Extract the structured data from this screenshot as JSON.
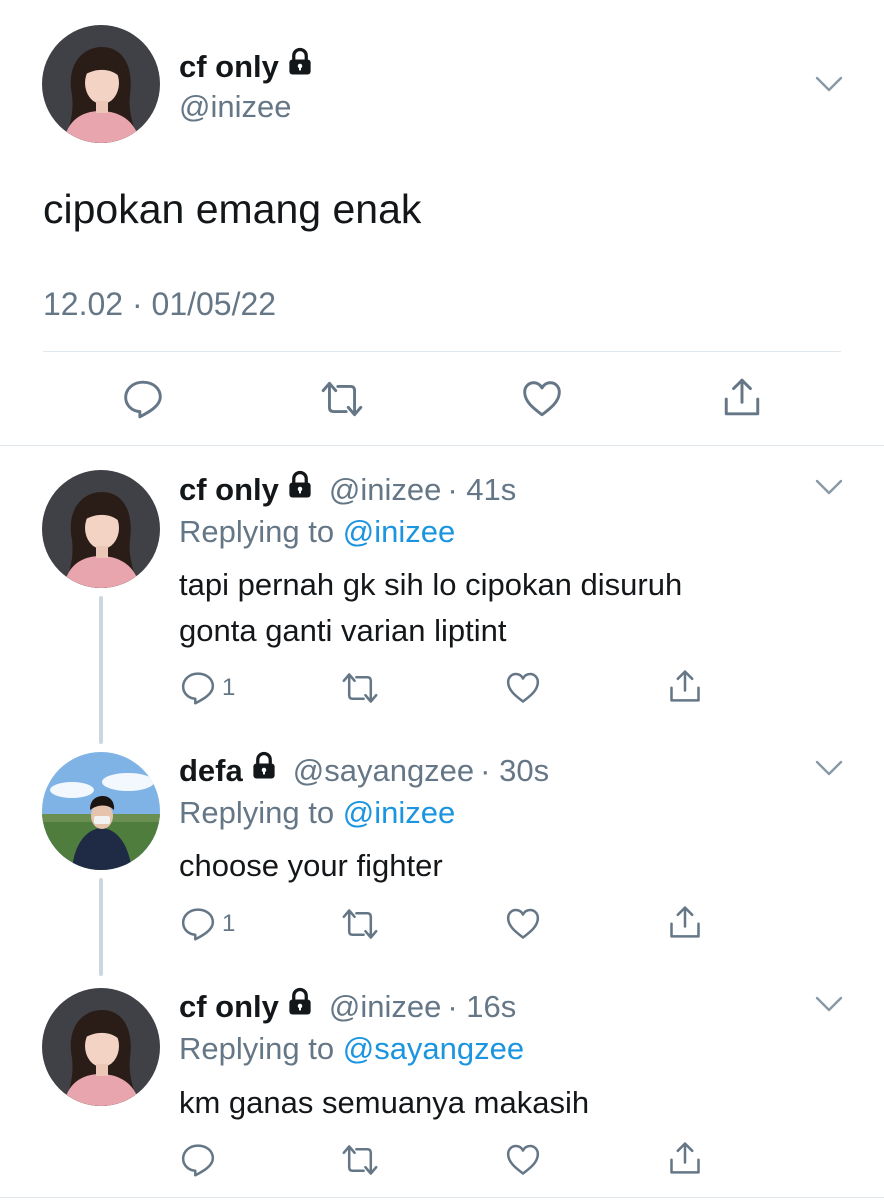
{
  "main_tweet": {
    "display_name": "cf only",
    "handle": "@inizee",
    "text": "cipokan emang enak",
    "timestamp": "12.02 · 01/05/22"
  },
  "replies": [
    {
      "display_name": "cf only",
      "handle": "@inizee",
      "time": "· 41s",
      "replying_prefix": "Replying to ",
      "replying_to": "@inizee",
      "text_line1": "tapi pernah gk sih lo cipokan disuruh",
      "text_line2": "gonta ganti varian liptint",
      "reply_count": "1"
    },
    {
      "display_name": "defa",
      "handle": "@sayangzee",
      "time": "· 30s",
      "replying_prefix": "Replying to ",
      "replying_to": "@inizee",
      "text_line1": "choose your fighter",
      "reply_count": "1"
    },
    {
      "display_name": "cf only",
      "handle": "@inizee",
      "time": "· 16s",
      "replying_prefix": "Replying to ",
      "replying_to": "@sayangzee",
      "text_line1": "km ganas semuanya makasih"
    }
  ],
  "icons": {
    "reply": "reply-icon",
    "retweet": "retweet-icon",
    "like": "heart-icon",
    "share": "share-icon",
    "lock": "lock-icon",
    "more": "chevron-down-icon"
  },
  "colors": {
    "text": "#14171a",
    "secondary": "#657786",
    "link": "#1b95e0",
    "divider": "#e1e8ed",
    "thread_line": "#ccd6dd"
  }
}
